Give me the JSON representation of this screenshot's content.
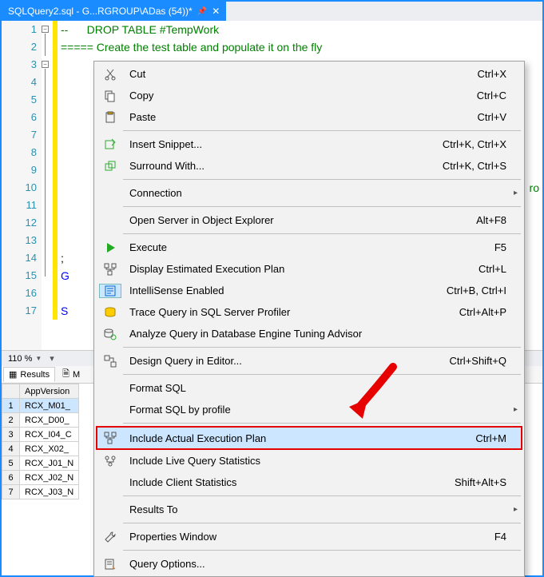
{
  "tab": {
    "title": "SQLQuery2.sql - G...RGROUP\\ADas (54))*"
  },
  "editor": {
    "lines": {
      "l1": "--      DROP TABLE #TempWork",
      "l2": "===== Create the test table and populate it on the fly",
      "l14": ";",
      "l15": "G",
      "l17": "S",
      "ro": "ro"
    },
    "line_numbers": [
      "1",
      "2",
      "3",
      "4",
      "5",
      "6",
      "7",
      "8",
      "9",
      "10",
      "11",
      "12",
      "13",
      "14",
      "15",
      "16",
      "17"
    ]
  },
  "zoom": "110 %",
  "result_tabs": {
    "results": "Results",
    "messages_initial": "M"
  },
  "grid": {
    "col": "AppVersion",
    "rows": [
      {
        "n": "1",
        "v": "RCX_M01_"
      },
      {
        "n": "2",
        "v": "RCX_D00_"
      },
      {
        "n": "3",
        "v": "RCX_I04_C"
      },
      {
        "n": "4",
        "v": "RCX_X02_"
      },
      {
        "n": "5",
        "v": "RCX_J01_N"
      },
      {
        "n": "6",
        "v": "RCX_J02_N"
      },
      {
        "n": "7",
        "v": "RCX_J03_N"
      }
    ]
  },
  "menu": {
    "cut": {
      "label": "Cut",
      "sc": "Ctrl+X"
    },
    "copy": {
      "label": "Copy",
      "sc": "Ctrl+C"
    },
    "paste": {
      "label": "Paste",
      "sc": "Ctrl+V"
    },
    "snippet": {
      "label": "Insert Snippet...",
      "sc": "Ctrl+K, Ctrl+X"
    },
    "surround": {
      "label": "Surround With...",
      "sc": "Ctrl+K, Ctrl+S"
    },
    "connection": {
      "label": "Connection"
    },
    "open_oe": {
      "label": "Open Server in Object Explorer",
      "sc": "Alt+F8"
    },
    "execute": {
      "label": "Execute",
      "sc": "F5"
    },
    "estplan": {
      "label": "Display Estimated Execution Plan",
      "sc": "Ctrl+L"
    },
    "intelli": {
      "label": "IntelliSense Enabled",
      "sc": "Ctrl+B, Ctrl+I"
    },
    "trace": {
      "label": "Trace Query in SQL Server Profiler",
      "sc": "Ctrl+Alt+P"
    },
    "analyze": {
      "label": "Analyze Query in Database Engine Tuning Advisor"
    },
    "design": {
      "label": "Design Query in Editor...",
      "sc": "Ctrl+Shift+Q"
    },
    "fmt": {
      "label": "Format SQL"
    },
    "fmtprof": {
      "label": "Format SQL by profile"
    },
    "actual": {
      "label": "Include Actual Execution Plan",
      "sc": "Ctrl+M"
    },
    "live": {
      "label": "Include Live Query Statistics"
    },
    "client": {
      "label": "Include Client Statistics",
      "sc": "Shift+Alt+S"
    },
    "results": {
      "label": "Results To"
    },
    "propwin": {
      "label": "Properties Window",
      "sc": "F4"
    },
    "qopts": {
      "label": "Query Options..."
    }
  }
}
